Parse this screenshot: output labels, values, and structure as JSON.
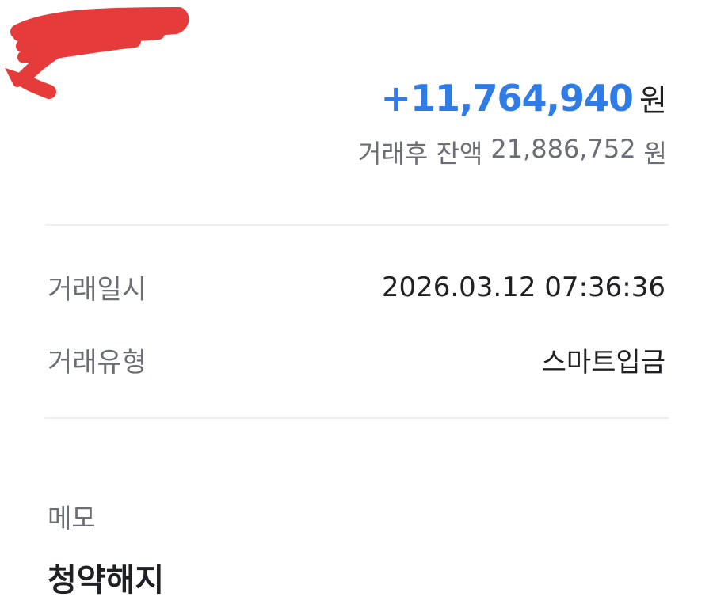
{
  "colors": {
    "amount": "#2f7ce6",
    "redaction": "#e63b3b",
    "label": "#6b6f75",
    "value": "#1f2023",
    "divider": "#eceef0"
  },
  "transaction": {
    "amount": "+11,764,940",
    "amount_unit": "원",
    "balance_label": "거래후 잔액",
    "balance_value": "21,886,752",
    "balance_unit": "원"
  },
  "details": {
    "datetime_label": "거래일시",
    "datetime_value": "2026.03.12 07:36:36",
    "type_label": "거래유형",
    "type_value": "스마트입금"
  },
  "memo": {
    "label": "메모",
    "value": "청약해지"
  }
}
